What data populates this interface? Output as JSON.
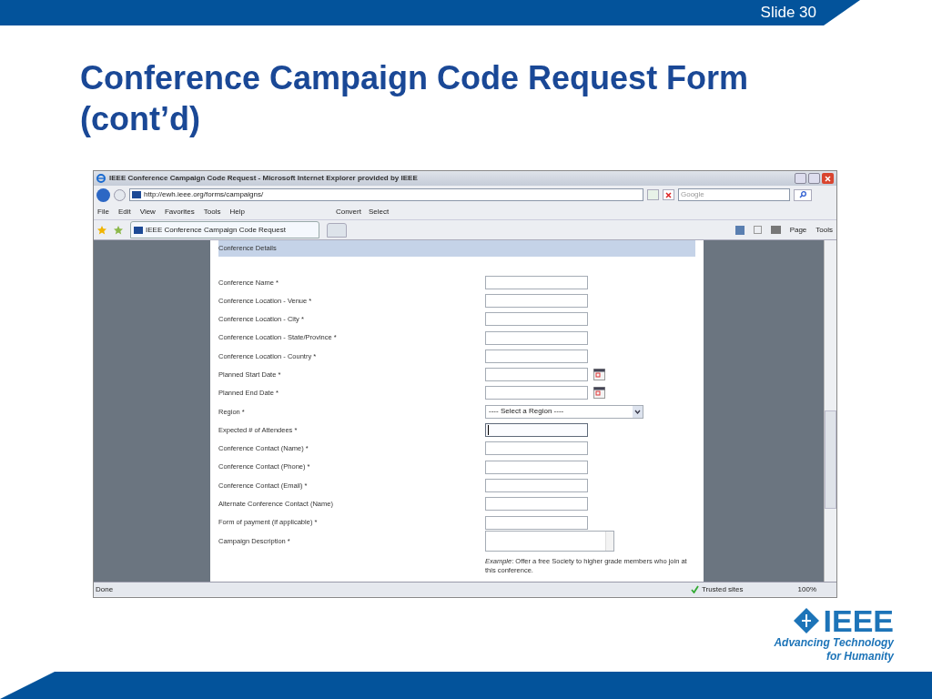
{
  "slide": {
    "number": "Slide 30",
    "title": "Conference Campaign Code Request Form (cont’d)"
  },
  "browser": {
    "title": "IEEE Conference Campaign Code Request - Microsoft Internet Explorer provided by IEEE",
    "address": "http://ewh.ieee.org/forms/campaigns/",
    "search_placeholder": "Google",
    "menu": [
      "File",
      "Edit",
      "View",
      "Favorites",
      "Tools",
      "Help"
    ],
    "toolbar": [
      "Convert",
      "Select"
    ],
    "tabs": [
      {
        "label": "IEEE Conference Campaign Code Request",
        "selected": true
      }
    ],
    "command_bar": [
      "Page",
      "Tools"
    ],
    "status": {
      "text": "Done",
      "zone": "Trusted sites",
      "zoom": "100%"
    }
  },
  "form": {
    "section": "Conference Details",
    "fields": [
      {
        "label": "Conference Name *",
        "kind": "text",
        "focused": false
      },
      {
        "label": "Conference Location - Venue *",
        "kind": "text",
        "focused": false
      },
      {
        "label": "Conference Location - City *",
        "kind": "text",
        "focused": false
      },
      {
        "label": "Conference Location - State/Province *",
        "kind": "text",
        "focused": false
      },
      {
        "label": "Conference Location - Country *",
        "kind": "text",
        "focused": false
      },
      {
        "label": "Planned Start Date *",
        "kind": "date",
        "focused": false
      },
      {
        "label": "Planned End Date *",
        "kind": "date",
        "focused": false
      },
      {
        "label": "Region *",
        "kind": "select",
        "value": "---- Select a Region ----",
        "focused": false
      },
      {
        "label": "Expected # of Attendees *",
        "kind": "text",
        "focused": true
      },
      {
        "label": "Conference Contact (Name) *",
        "kind": "text",
        "focused": false
      },
      {
        "label": "Conference Contact (Phone) *",
        "kind": "text",
        "focused": false
      },
      {
        "label": "Conference Contact (Email) *",
        "kind": "text",
        "focused": false
      },
      {
        "label": "Alternate Conference Contact (Name)",
        "kind": "text",
        "focused": false
      },
      {
        "label": "Form of payment (if applicable) *",
        "kind": "text",
        "focused": false
      },
      {
        "label": "Campaign Description *",
        "kind": "textarea",
        "focused": false
      }
    ],
    "hint": "*Example*: Offer a free Society to higher grade members who join at this conference."
  },
  "logo": {
    "name": "IEEE",
    "tagline_1": "Advancing Technology",
    "tagline_2": "for Humanity"
  }
}
